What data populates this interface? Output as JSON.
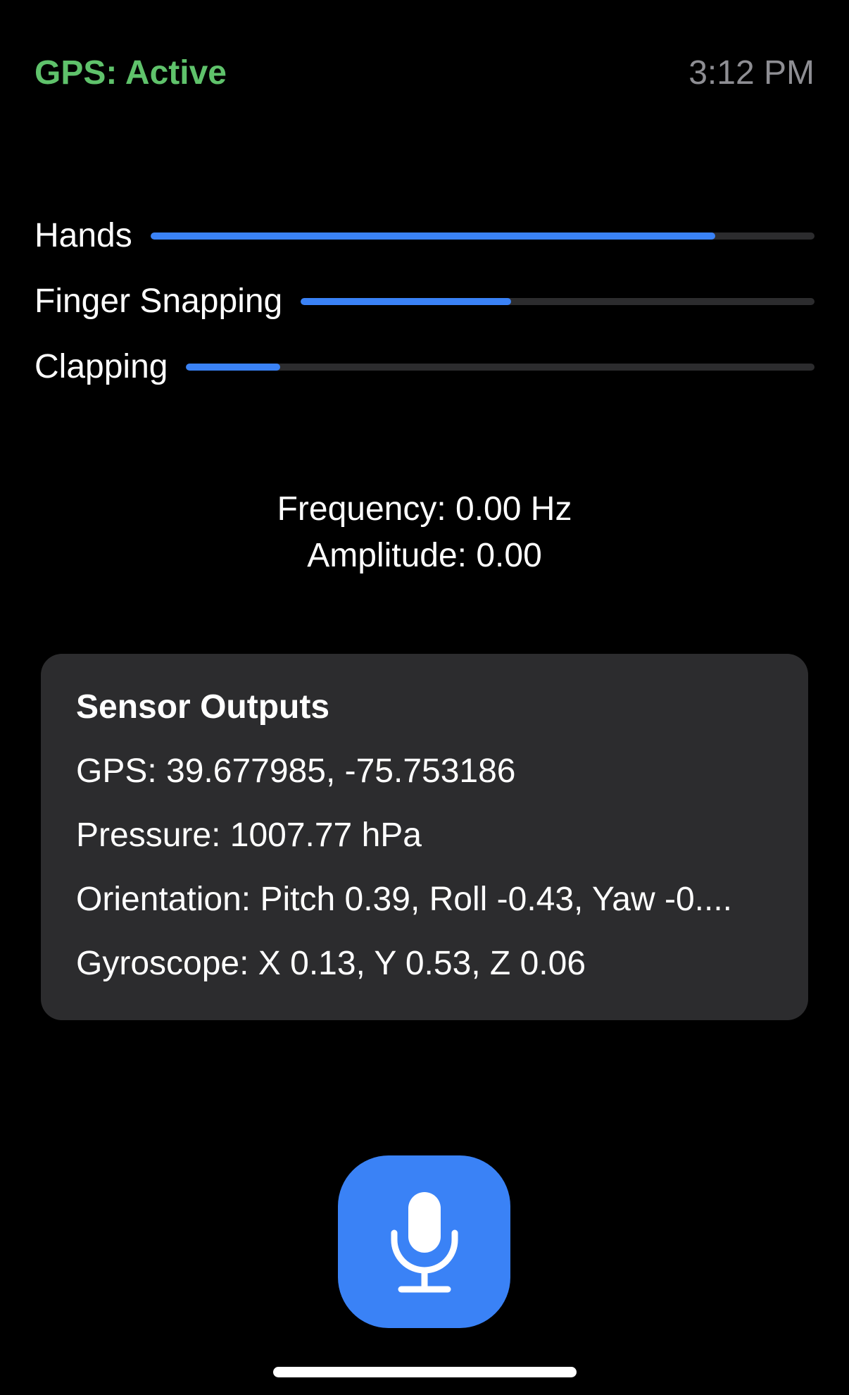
{
  "status": {
    "gps": "GPS: Active",
    "time": "3:12 PM"
  },
  "levels": [
    {
      "label": "Hands",
      "progress": 0.85
    },
    {
      "label": "Finger Snapping",
      "progress": 0.41
    },
    {
      "label": "Clapping",
      "progress": 0.15
    }
  ],
  "readout": {
    "frequency": "Frequency: 0.00 Hz",
    "amplitude": "Amplitude: 0.00"
  },
  "sensors": {
    "title": "Sensor Outputs",
    "gps": "GPS: 39.677985, -75.753186",
    "pressure": "Pressure: 1007.77 hPa",
    "orientation": "Orientation: Pitch 0.39, Roll -0.43, Yaw -0....",
    "gyroscope": "Gyroscope: X 0.13, Y 0.53, Z 0.06"
  },
  "mic": {
    "icon": "microphone-icon"
  },
  "colors": {
    "accent": "#3a82f6",
    "gps_active": "#5fc26b",
    "card": "#2c2c2e",
    "track": "#2c2c2e",
    "clock": "#8e8e93"
  }
}
